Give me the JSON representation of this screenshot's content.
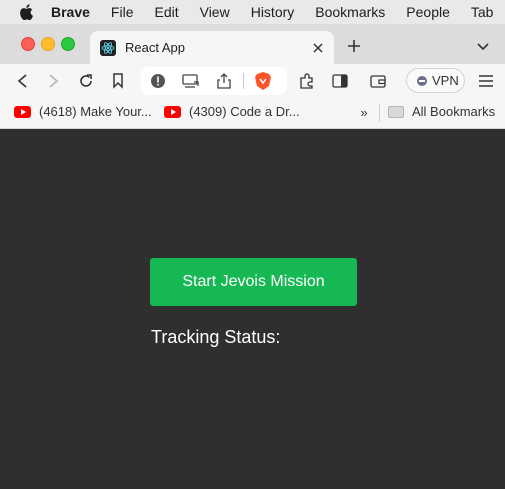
{
  "menubar": {
    "app_name": "Brave",
    "items": [
      "File",
      "Edit",
      "View",
      "History",
      "Bookmarks",
      "People",
      "Tab"
    ]
  },
  "tab": {
    "title": "React App",
    "favicon": "react-icon"
  },
  "toolbar": {
    "vpn_label": "VPN"
  },
  "bookmarks": {
    "items": [
      {
        "label": "(4618) Make Your...",
        "icon": "youtube-icon"
      },
      {
        "label": "(4309) Code a Dr...",
        "icon": "youtube-icon"
      }
    ],
    "more": "»",
    "all_label": "All Bookmarks"
  },
  "page": {
    "start_button_label": "Start Jevois Mission",
    "tracking_status_label": "Tracking Status:"
  },
  "colors": {
    "page_background": "#2f2f2f",
    "start_button": "#16b853",
    "brave_shield": "#fb542b"
  }
}
